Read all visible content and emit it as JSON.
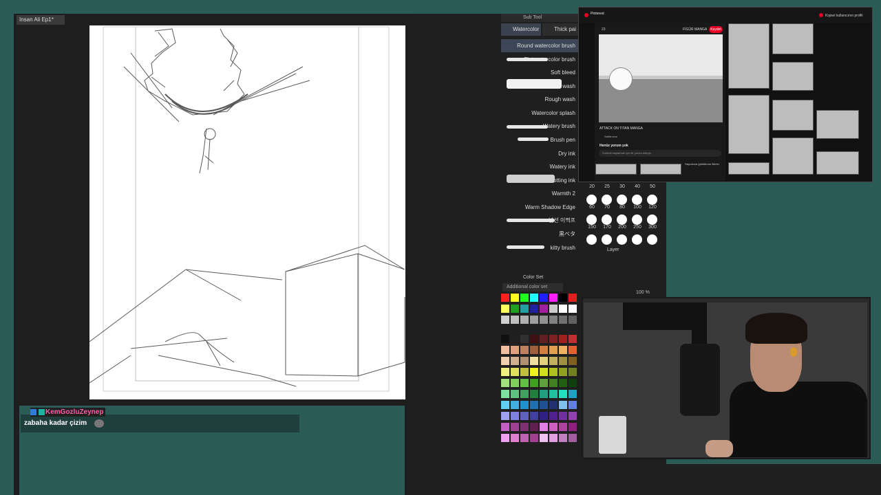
{
  "document": {
    "tab_title": "Insan Ali Ep1*"
  },
  "subtool": {
    "header": "Sub Tool",
    "tabs": [
      "Watercolor",
      "Thick pai"
    ],
    "brushes": [
      "Round watercolor brush",
      "Flat watercolor brush",
      "Soft bleed",
      "Wet wash",
      "Rough wash",
      "Watercolor splash",
      "Watery brush",
      "Brush pen",
      "Dry ink",
      "Watery ink",
      "Wet blotting ink",
      "Warmth 2",
      "Warm Shadow Edge",
      "넘션 이쩍프",
      "黒ベタ",
      "kitty brush"
    ]
  },
  "brush_sizes": [
    "20",
    "25",
    "30",
    "40",
    "50",
    "60",
    "70",
    "80",
    "100",
    "120",
    "150",
    "170",
    "200",
    "250",
    "300"
  ],
  "layer": {
    "header": "Layer",
    "opacity": "100 %"
  },
  "color_set": {
    "header": "Color Set",
    "dropdown": "Additional color set",
    "swatches": [
      [
        "#ff2020",
        "#ffff20",
        "#20ff20",
        "#20ffff",
        "#2020ff",
        "#ff20ff",
        "#000000",
        "#e02020"
      ],
      [
        "#ffff60",
        "#20a020",
        "#20a0a0",
        "#2020a0",
        "#a020a0",
        "#cccccc",
        "#ffffff",
        "#ffffff"
      ],
      [
        "#d0d0d0",
        "#c0c0c0",
        "#b0b0b0",
        "#a0a0a0",
        "#909090",
        "#808080",
        "#707070",
        "#606060"
      ],
      [
        "#101010",
        "#202020",
        "#303030",
        "#401010",
        "#602020",
        "#802020",
        "#a02020",
        "#c03030"
      ],
      [
        "#f0c0a0",
        "#e0a080",
        "#c08060",
        "#a06040",
        "#d08040",
        "#e0a050",
        "#f0b060",
        "#e06030"
      ],
      [
        "#f0d0b0",
        "#d0b090",
        "#b09070",
        "#f0e0a0",
        "#e0d080",
        "#c0b060",
        "#a09040",
        "#806020"
      ],
      [
        "#f0f080",
        "#e0e060",
        "#c0c040",
        "#f0f020",
        "#d0e020",
        "#b0c020",
        "#90a020",
        "#708020"
      ],
      [
        "#a0e080",
        "#80d060",
        "#60c040",
        "#40a020",
        "#60a040",
        "#408020",
        "#206010",
        "#104010"
      ],
      [
        "#80e0a0",
        "#60c080",
        "#40a060",
        "#208040",
        "#20a080",
        "#20c0a0",
        "#20e0c0",
        "#20a0c0"
      ],
      [
        "#60d0f0",
        "#40b0e0",
        "#2090d0",
        "#2070b0",
        "#205090",
        "#203070",
        "#80c0f0",
        "#6080e0"
      ],
      [
        "#a0a0f0",
        "#8080e0",
        "#6060c0",
        "#4040a0",
        "#302080",
        "#502090",
        "#7030a0",
        "#9040b0"
      ],
      [
        "#c060c0",
        "#a04090",
        "#803070",
        "#602050",
        "#e080e0",
        "#d060c0",
        "#b040a0",
        "#902080"
      ],
      [
        "#f0a0f0",
        "#e080d0",
        "#c060b0",
        "#a04090",
        "#f0c0f0",
        "#e0a0e0",
        "#c080c0",
        "#a060a0"
      ]
    ]
  },
  "chat": {
    "username": "KemGozluZeynep",
    "message": "zabaha kadar çizim"
  },
  "browser": {
    "app_name": "Pinterest",
    "profile": "Kişisel kullanıcının profili",
    "likes": "23",
    "board": "FİGÜR MANGA",
    "save_label": "Kaydet",
    "pin_title": "ATTACK ON TITAN MANGA",
    "author": "Sarita smz",
    "comments_heading": "Henüz yorum yok",
    "comment_placeholder": "Sohbeti başlatmak için bir yorum ekleyin",
    "more_ideas": "Hayranıza göddibrum fikirler"
  },
  "colors": {
    "background": "#2b5b57",
    "pinterest_red": "#e60023",
    "chat_name": "#ff5da8"
  }
}
